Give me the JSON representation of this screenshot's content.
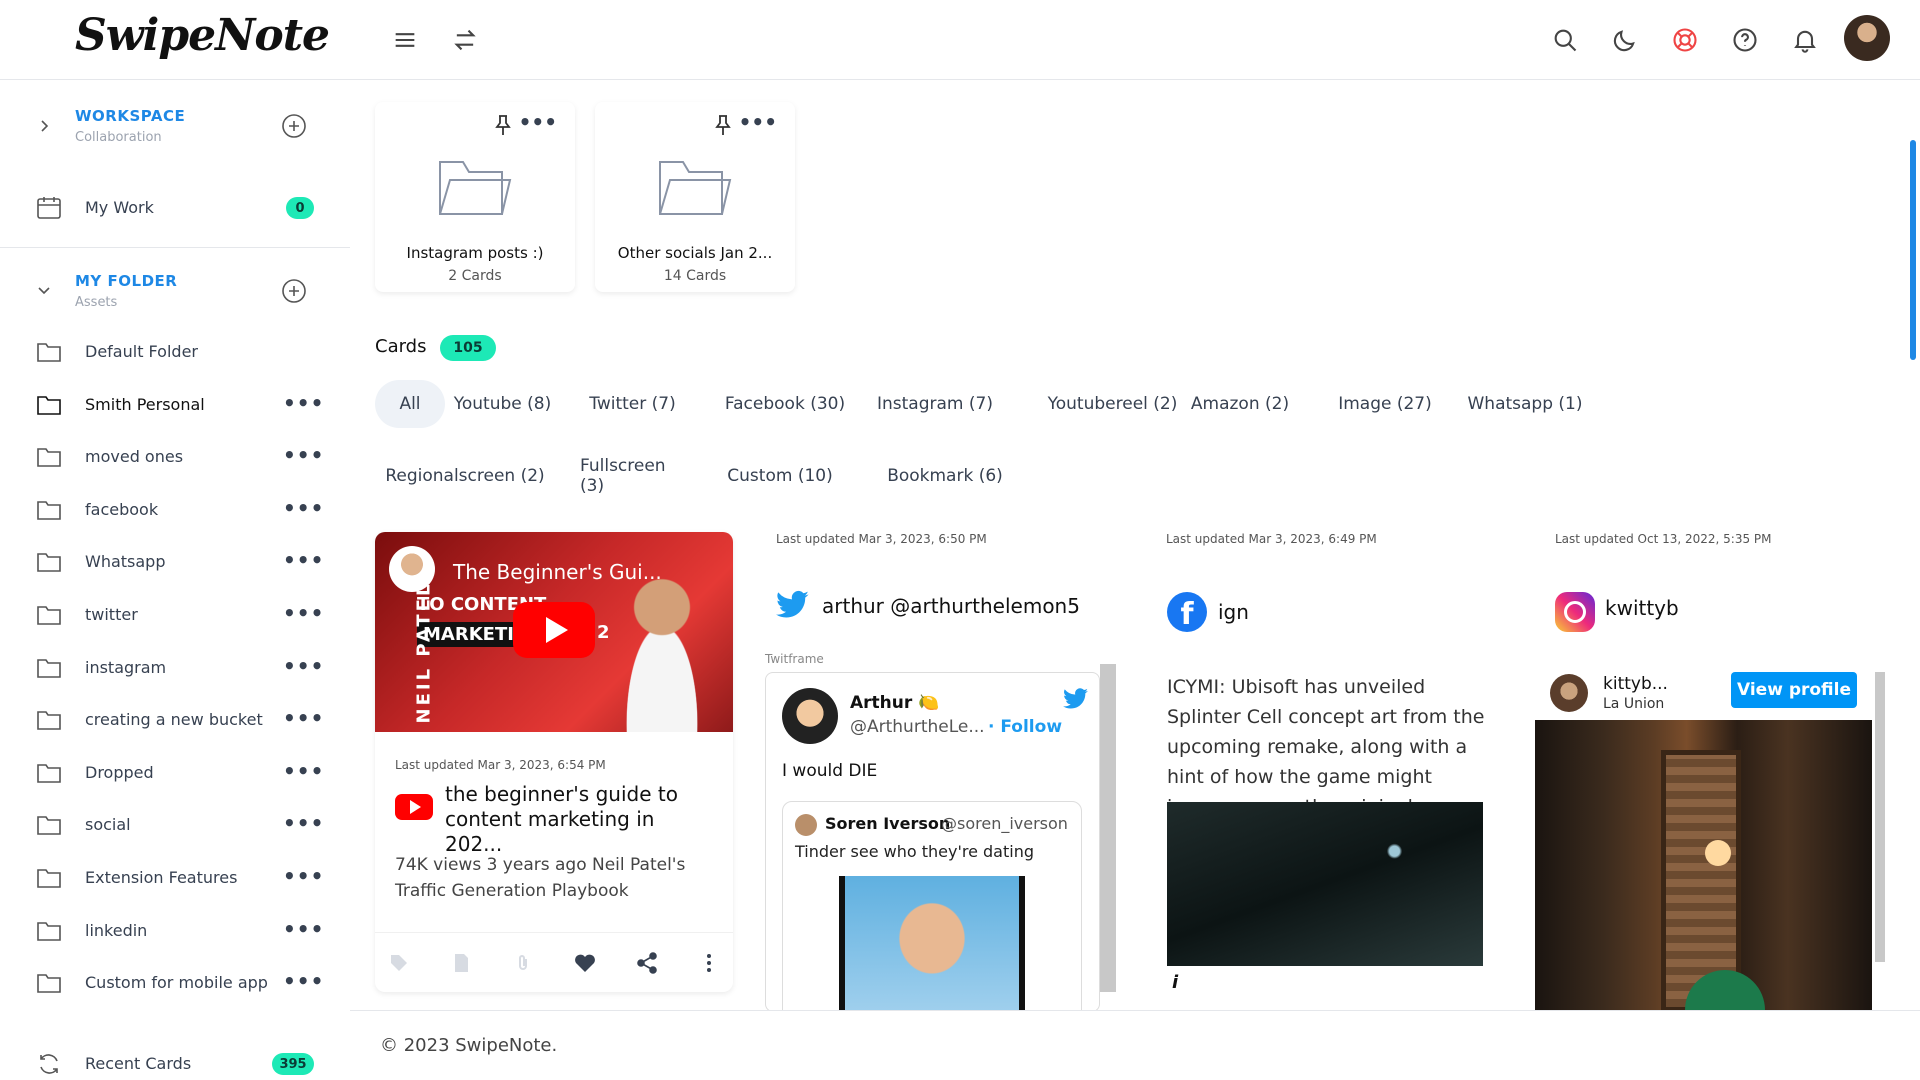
{
  "header": {
    "logo_text": "SwipeNote",
    "icons": [
      "menu-icon",
      "swap-icon",
      "search-icon",
      "moon-icon",
      "lifebuoy-icon",
      "help-icon",
      "bell-icon"
    ],
    "accent_color": "#1e88e5",
    "lifebuoy_color": "#ef4444"
  },
  "sidebar": {
    "workspace": {
      "title": "WORKSPACE",
      "subtitle": "Collaboration"
    },
    "my_work": {
      "label": "My Work",
      "count": "0"
    },
    "my_folder": {
      "title": "MY FOLDER",
      "subtitle": "Assets"
    },
    "folders": [
      {
        "label": "Default Folder",
        "has_menu": false
      },
      {
        "label": "Smith Personal",
        "has_menu": true,
        "selected": true
      },
      {
        "label": "moved ones",
        "has_menu": true
      },
      {
        "label": "facebook",
        "has_menu": true
      },
      {
        "label": "Whatsapp",
        "has_menu": true
      },
      {
        "label": "twitter",
        "has_menu": true
      },
      {
        "label": "instagram",
        "has_menu": true
      },
      {
        "label": "creating a new bucket",
        "has_menu": true
      },
      {
        "label": "Dropped",
        "has_menu": true
      },
      {
        "label": "social",
        "has_menu": true
      },
      {
        "label": "Extension Features",
        "has_menu": true
      },
      {
        "label": "linkedin",
        "has_menu": true
      },
      {
        "label": "Custom for mobile app",
        "has_menu": true
      }
    ],
    "recent": {
      "label": "Recent Cards",
      "count": "395"
    },
    "menu_glyph": "•••"
  },
  "folder_cards": [
    {
      "name": "Instagram posts :)",
      "count": "2 Cards"
    },
    {
      "name": "Other socials Jan 2...",
      "count": "14 Cards"
    }
  ],
  "cards_section": {
    "title": "Cards",
    "count": "105",
    "filters_row1": [
      "All",
      "Youtube (8)",
      "Twitter (7)",
      "Facebook (30)",
      "Instagram (7)",
      "Youtubereel (2)",
      "Amazon (2)",
      "Image (27)",
      "Whatsapp (1)"
    ],
    "filters_row2": [
      "Regionalscreen (2)",
      "Fullscreen (3)",
      "Custom (10)",
      "Bookmark (6)"
    ],
    "active_filter": "All",
    "badge_color": "#1de9b6"
  },
  "cards": {
    "youtube": {
      "thumb_title": "The Beginner's Gui...",
      "thumb_tag_a": "TO CONTENT",
      "thumb_tag_b": "MARKETIN",
      "thumb_number": "2",
      "thumb_side": "NEIL PATEL",
      "updated": "Last updated Mar 3, 2023, 6:54 PM",
      "title": "the beginner's guide to content marketing in 202...",
      "description": "74K views 3 years ago Neil Patel's Traffic Generation Playbook",
      "actions": [
        "tag-icon",
        "note-icon",
        "attachment-icon",
        "heart-icon",
        "share-icon",
        "more-vertical-icon"
      ]
    },
    "twitter": {
      "updated": "Last updated Mar 3, 2023, 6:50 PM",
      "handle": "arthur @arthurthelemon5",
      "frame_label": "Twitframe",
      "tweet_name": "Arthur 🍋",
      "tweet_user": "@ArthurtheLe...",
      "follow": "· Follow",
      "tweet_text": "I would DIE",
      "quote_name": "Soren Iverson",
      "quote_user": "@soren_iverson",
      "quote_text": "Tinder see who they're dating"
    },
    "facebook": {
      "updated": "Last updated Mar 3, 2023, 6:49 PM",
      "name": "ign",
      "logo_letter": "f",
      "text": "ICYMI: Ubisoft has unveiled Splinter Cell concept art from the upcoming remake, along with a hint of how the game might improve upon the original.",
      "info": "i"
    },
    "instagram": {
      "updated": "Last updated Oct 13, 2022, 5:35 PM",
      "name": "kwittyb",
      "profile_name": "kittyb...",
      "profile_location": "La Union",
      "view_profile": "View profile",
      "next_arrow": "›"
    }
  },
  "footer": {
    "copyright": "© 2023 SwipeNote."
  }
}
